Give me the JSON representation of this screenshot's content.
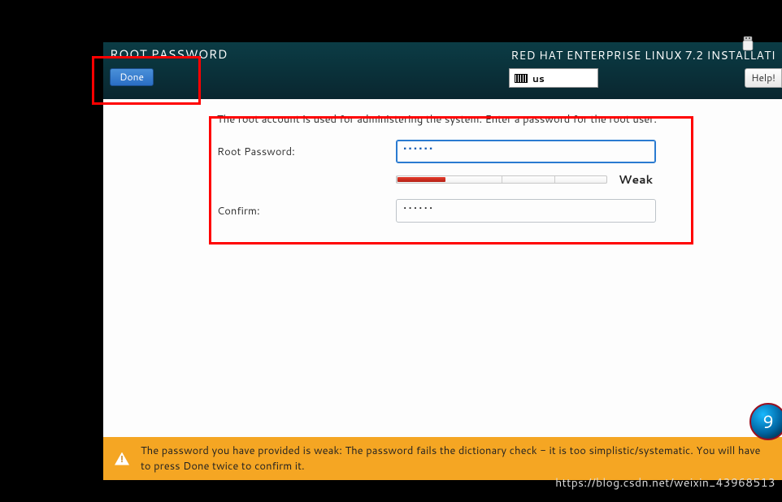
{
  "header": {
    "title": "ROOT PASSWORD",
    "installer_name": "RED HAT ENTERPRISE LINUX 7.2 INSTALLATI",
    "done_label": "Done",
    "help_label": "Help!",
    "keyboard_layout": "us",
    "keyboard_icon": "keyboard-icon"
  },
  "content": {
    "intro": "The root account is used for administering the system.  Enter a password for the root user.",
    "root_password_label": "Root Password:",
    "confirm_label": "Confirm:",
    "root_password_value": "••••••",
    "confirm_value": "••••••",
    "strength_label": "Weak",
    "strength_fraction": 0.23
  },
  "warning": {
    "text": "The password you have provided is weak: The password fails the dictionary check - it is too simplistic/systematic. You will have to press Done twice to confirm it."
  },
  "watermark": "https://blog.csdn.net/weixin_43968513",
  "badge_number": "9"
}
